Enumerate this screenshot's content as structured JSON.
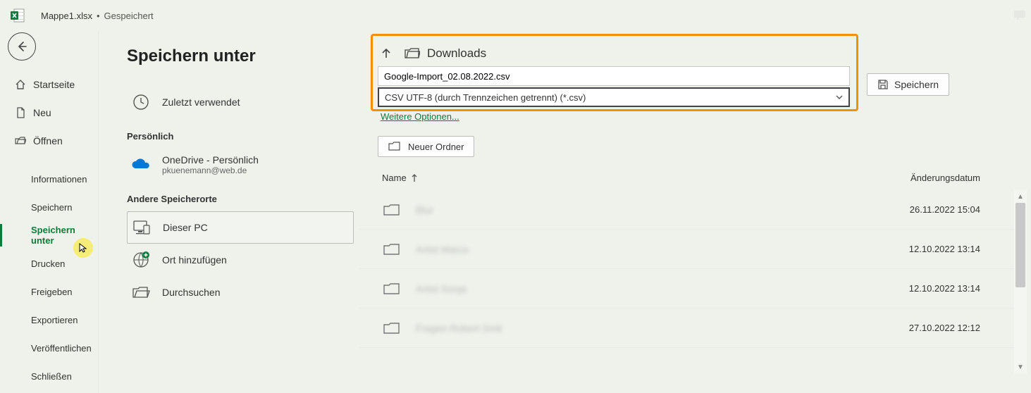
{
  "titlebar": {
    "filename": "Mappe1.xlsx",
    "separator": "•",
    "status": "Gespeichert"
  },
  "nav": {
    "home": "Startseite",
    "new": "Neu",
    "open": "Öffnen",
    "info": "Informationen",
    "save": "Speichern",
    "saveas": "Speichern unter",
    "print": "Drucken",
    "share": "Freigeben",
    "export": "Exportieren",
    "publish": "Veröffentlichen",
    "close": "Schließen"
  },
  "page_title": "Speichern unter",
  "locations": {
    "recent": "Zuletzt verwendet",
    "group_personal": "Persönlich",
    "onedrive_label": "OneDrive - Persönlich",
    "onedrive_sub": "pkuenemann@web.de",
    "group_other": "Andere Speicherorte",
    "this_pc": "Dieser PC",
    "add_place": "Ort hinzufügen",
    "browse": "Durchsuchen"
  },
  "path": {
    "crumb": "Downloads"
  },
  "filename_value": "Google-Import_02.08.2022.csv",
  "filetype_value": "CSV UTF-8 (durch Trennzeichen getrennt) (*.csv)",
  "more_options": "Weitere Optionen...",
  "save_button": "Speichern",
  "new_folder": "Neuer Ordner",
  "table": {
    "name_header": "Name",
    "date_header": "Änderungsdatum"
  },
  "files": [
    {
      "name": "Blur",
      "date": "26.11.2022 15:04"
    },
    {
      "name": "Artist Marco",
      "date": "12.10.2022 13:14"
    },
    {
      "name": "Artist Sonja",
      "date": "12.10.2022 13:14"
    },
    {
      "name": "Fragen Robert Smit",
      "date": "27.10.2022 12:12"
    }
  ]
}
